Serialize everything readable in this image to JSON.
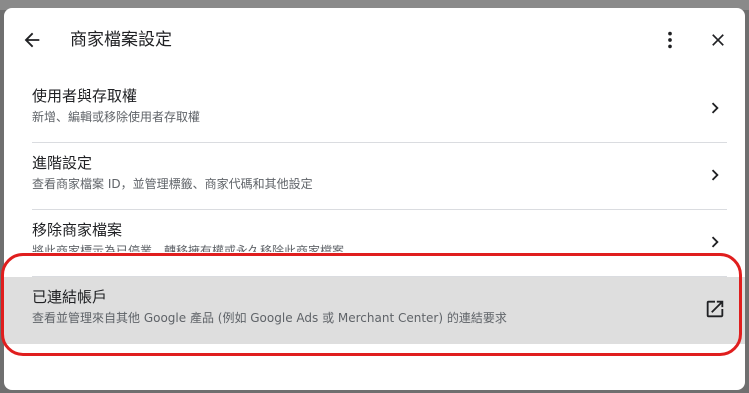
{
  "dialog": {
    "title": "商家檔案設定",
    "back_icon": "arrow-back-icon",
    "more_icon": "more-vert-icon",
    "close_icon": "close-icon"
  },
  "items": [
    {
      "title": "使用者與存取權",
      "subtitle": "新增、編輯或移除使用者存取權",
      "trailing_icon": "chevron-right-icon"
    },
    {
      "title": "進階設定",
      "subtitle": "查看商家檔案 ID，並管理標籤、商家代碼和其他設定",
      "trailing_icon": "chevron-right-icon"
    },
    {
      "title": "移除商家檔案",
      "subtitle": "將此商家標示為已停業、轉移擁有權或永久移除此商家檔案",
      "trailing_icon": "chevron-right-icon"
    },
    {
      "title": "已連結帳戶",
      "subtitle": "查看並管理來自其他 Google 產品 (例如 Google Ads 或 Merchant Center) 的連結要求",
      "trailing_icon": "open-in-new-icon"
    }
  ],
  "colors": {
    "highlight_ring": "#e01e1e",
    "highlight_bg": "#dedede"
  }
}
